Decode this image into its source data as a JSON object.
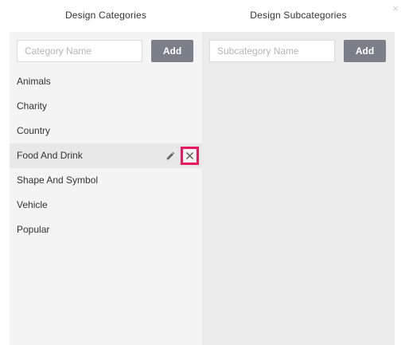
{
  "dialog": {
    "close_glyph": "×"
  },
  "categories": {
    "title": "Design Categories",
    "input_placeholder": "Category Name",
    "input_value": "",
    "add_label": "Add",
    "items": [
      {
        "label": "Animals"
      },
      {
        "label": "Charity"
      },
      {
        "label": "Country"
      },
      {
        "label": "Food And Drink",
        "selected": true
      },
      {
        "label": "Shape And Symbol"
      },
      {
        "label": "Vehicle"
      },
      {
        "label": "Popular"
      }
    ],
    "selected_actions": {
      "edit_icon": "pencil-icon",
      "delete_icon": "close-icon",
      "delete_highlight_color": "#e8195d"
    }
  },
  "subcategories": {
    "title": "Design Subcategories",
    "input_placeholder": "Subcategory Name",
    "input_value": "",
    "add_label": "Add",
    "items": []
  },
  "colors": {
    "button_bg": "#7b8088",
    "left_panel_bg": "#f4f4f4",
    "right_panel_bg": "#ebebeb",
    "selected_row_bg": "#e8e8e8"
  }
}
